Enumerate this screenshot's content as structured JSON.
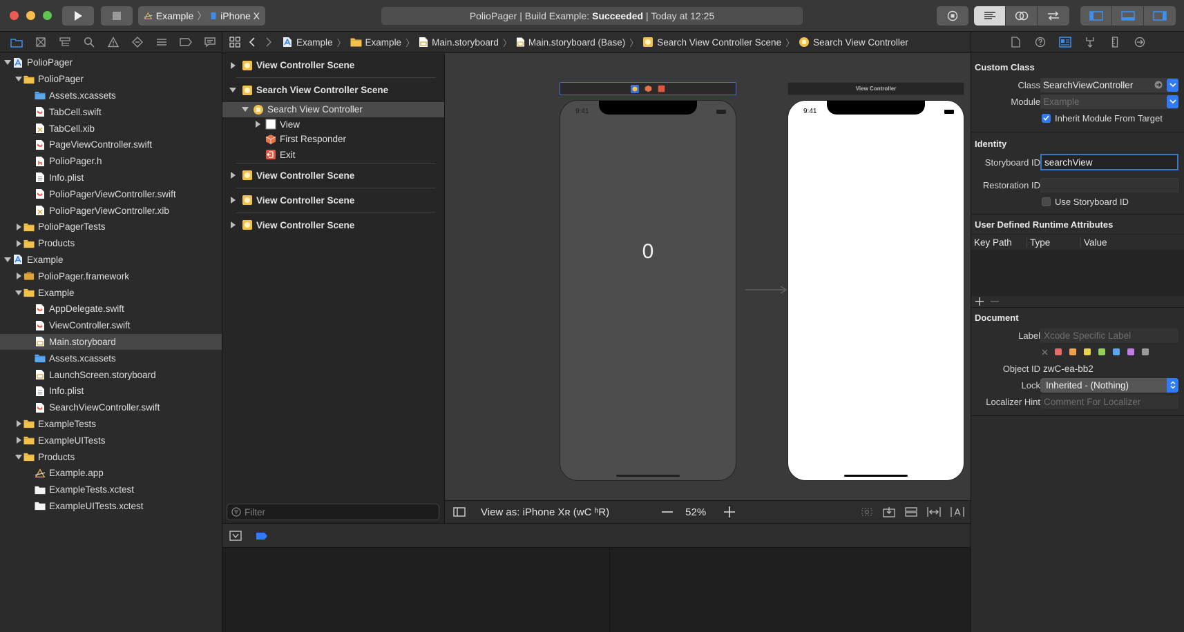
{
  "toolbar": {
    "scheme_target": "Example",
    "scheme_device": "iPhone X",
    "status_prefix": "PolioPager | Build Example:",
    "status_result": "Succeeded",
    "status_suffix": "| Today at 12:25"
  },
  "navigator": {
    "items": [
      {
        "label": "PolioPager",
        "indent": 0,
        "icon": "project",
        "disclosure": "open"
      },
      {
        "label": "PolioPager",
        "indent": 1,
        "icon": "folder",
        "disclosure": "open"
      },
      {
        "label": "Assets.xcassets",
        "indent": 2,
        "icon": "assets",
        "disclosure": ""
      },
      {
        "label": "TabCell.swift",
        "indent": 2,
        "icon": "swift",
        "disclosure": ""
      },
      {
        "label": "TabCell.xib",
        "indent": 2,
        "icon": "xib",
        "disclosure": ""
      },
      {
        "label": "PageViewController.swift",
        "indent": 2,
        "icon": "swift",
        "disclosure": ""
      },
      {
        "label": "PolioPager.h",
        "indent": 2,
        "icon": "header",
        "disclosure": ""
      },
      {
        "label": "Info.plist",
        "indent": 2,
        "icon": "plist",
        "disclosure": ""
      },
      {
        "label": "PolioPagerViewController.swift",
        "indent": 2,
        "icon": "swift",
        "disclosure": ""
      },
      {
        "label": "PolioPagerViewController.xib",
        "indent": 2,
        "icon": "xib",
        "disclosure": ""
      },
      {
        "label": "PolioPagerTests",
        "indent": 1,
        "icon": "folder",
        "disclosure": "closed"
      },
      {
        "label": "Products",
        "indent": 1,
        "icon": "folder",
        "disclosure": "closed"
      },
      {
        "label": "Example",
        "indent": 0,
        "icon": "project",
        "disclosure": "open"
      },
      {
        "label": "PolioPager.framework",
        "indent": 1,
        "icon": "framework",
        "disclosure": "closed"
      },
      {
        "label": "Example",
        "indent": 1,
        "icon": "folder",
        "disclosure": "open"
      },
      {
        "label": "AppDelegate.swift",
        "indent": 2,
        "icon": "swift",
        "disclosure": ""
      },
      {
        "label": "ViewController.swift",
        "indent": 2,
        "icon": "swift",
        "disclosure": ""
      },
      {
        "label": "Main.storyboard",
        "indent": 2,
        "icon": "storyboard",
        "disclosure": "",
        "selected": true
      },
      {
        "label": "Assets.xcassets",
        "indent": 2,
        "icon": "assets",
        "disclosure": ""
      },
      {
        "label": "LaunchScreen.storyboard",
        "indent": 2,
        "icon": "storyboard",
        "disclosure": ""
      },
      {
        "label": "Info.plist",
        "indent": 2,
        "icon": "plist",
        "disclosure": ""
      },
      {
        "label": "SearchViewController.swift",
        "indent": 2,
        "icon": "swift",
        "disclosure": ""
      },
      {
        "label": "ExampleTests",
        "indent": 1,
        "icon": "folder",
        "disclosure": "closed"
      },
      {
        "label": "ExampleUITests",
        "indent": 1,
        "icon": "folder",
        "disclosure": "closed"
      },
      {
        "label": "Products",
        "indent": 1,
        "icon": "folder",
        "disclosure": "open"
      },
      {
        "label": "Example.app",
        "indent": 2,
        "icon": "app",
        "disclosure": ""
      },
      {
        "label": "ExampleTests.xctest",
        "indent": 2,
        "icon": "xctest",
        "disclosure": ""
      },
      {
        "label": "ExampleUITests.xctest",
        "indent": 2,
        "icon": "xctest",
        "disclosure": ""
      }
    ]
  },
  "jumpbar": {
    "items": [
      {
        "label": "Example",
        "icon": "project"
      },
      {
        "label": "Example",
        "icon": "folder"
      },
      {
        "label": "Main.storyboard",
        "icon": "storyboard"
      },
      {
        "label": "Main.storyboard (Base)",
        "icon": "storyboard-file"
      },
      {
        "label": "Search View Controller Scene",
        "icon": "scene"
      },
      {
        "label": "Search View Controller",
        "icon": "vc"
      }
    ]
  },
  "outline": {
    "scene1": "View Controller Scene",
    "scene2": "Search View Controller Scene",
    "vc": "Search View Controller",
    "view": "View",
    "first_responder": "First Responder",
    "exit": "Exit",
    "scene3": "View Controller Scene",
    "scene4": "View Controller Scene",
    "scene5": "View Controller Scene",
    "filter_placeholder": "Filter"
  },
  "canvas": {
    "phone1_time": "9:41",
    "phone1_label": "0",
    "phone2_title": "View Controller",
    "phone2_time": "9:41",
    "view_as": "View as: iPhone Xʀ (ᴡC ʰR)",
    "zoom": "52%"
  },
  "inspector": {
    "custom_class_title": "Custom Class",
    "class_label": "Class",
    "class_value": "SearchViewController",
    "module_label": "Module",
    "module_placeholder": "Example",
    "inherit_label": "Inherit Module From Target",
    "identity_title": "Identity",
    "storyboard_id_label": "Storyboard ID",
    "storyboard_id_value": "searchView",
    "restoration_id_label": "Restoration ID",
    "use_storyboard_id_label": "Use Storyboard ID",
    "udra_title": "User Defined Runtime Attributes",
    "col_key_path": "Key Path",
    "col_type": "Type",
    "col_value": "Value",
    "document_title": "Document",
    "label_label": "Label",
    "label_placeholder": "Xcode Specific Label",
    "object_id_label": "Object ID",
    "object_id_value": "zwC-ea-bb2",
    "lock_label": "Lock",
    "lock_value": "Inherited - (Nothing)",
    "localizer_label": "Localizer Hint",
    "localizer_placeholder": "Comment For Localizer",
    "swatches": [
      "#e86b6b",
      "#f0a04b",
      "#e9d24a",
      "#93cf5a",
      "#5aa7f0",
      "#c27ce6",
      "#9a9a9a"
    ]
  },
  "colors": {
    "accent": "#2f7cf6",
    "folder": "#f2c14e",
    "selection": "#464646"
  }
}
